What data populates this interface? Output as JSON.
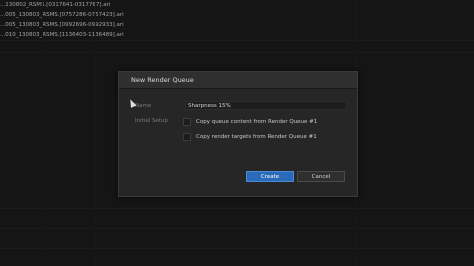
{
  "file_list": [
    "...130802_RSMS.[0317641-0317767].ari",
    "...005_130803_RSMS.[0757286-0757423].ari",
    "...005_130803_RSMS.[0992696-0992933].ari",
    "...010_130803_RSMS.[1136403-1136489].ari"
  ],
  "dialog": {
    "title": "New Render Queue",
    "name_label": "Name",
    "name_value": "Sharpness 15%",
    "initial_setup_label": "Initial Setup",
    "copy_queue_label": "Copy queue content from Render Queue #1",
    "copy_targets_label": "Copy render targets from Render Queue #1",
    "copy_queue_checked": false,
    "copy_targets_checked": false,
    "create_label": "Create",
    "cancel_label": "Cancel"
  },
  "colors": {
    "accent": "#2a6ab8",
    "background": "#1b1b1b",
    "dialog": "#262626"
  }
}
